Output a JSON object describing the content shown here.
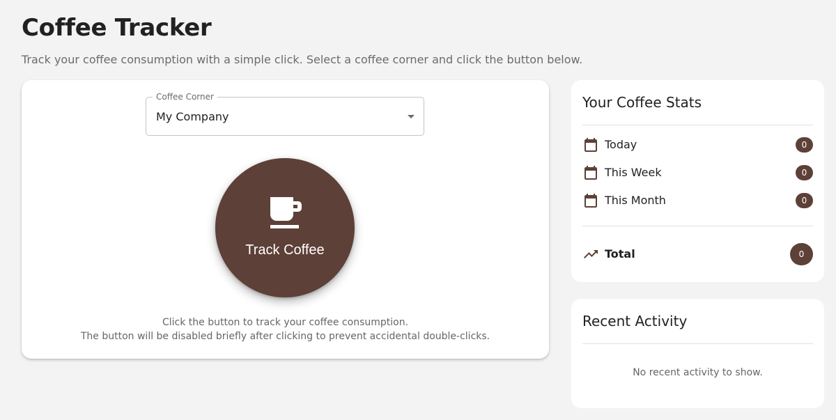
{
  "header": {
    "title": "Coffee Tracker",
    "subtitle": "Track your coffee consumption with a simple click. Select a coffee corner and click the button below."
  },
  "tracker": {
    "select": {
      "label": "Coffee Corner",
      "value": "My Company"
    },
    "button_label": "Track Coffee",
    "help_line_1": "Click the button to track your coffee consumption.",
    "help_line_2": "The button will be disabled briefly after clicking to prevent accidental double-clicks."
  },
  "stats": {
    "title": "Your Coffee Stats",
    "rows": [
      {
        "label": "Today",
        "count": "0",
        "icon": "calendar-icon"
      },
      {
        "label": "This Week",
        "count": "0",
        "icon": "calendar-icon"
      },
      {
        "label": "This Month",
        "count": "0",
        "icon": "calendar-icon"
      }
    ],
    "total": {
      "label": "Total",
      "count": "0",
      "icon": "trending-up-icon"
    }
  },
  "activity": {
    "title": "Recent Activity",
    "empty_message": "No recent activity to show."
  },
  "colors": {
    "accent": "#5d4037",
    "background": "#f3f3f3",
    "card": "#ffffff"
  }
}
